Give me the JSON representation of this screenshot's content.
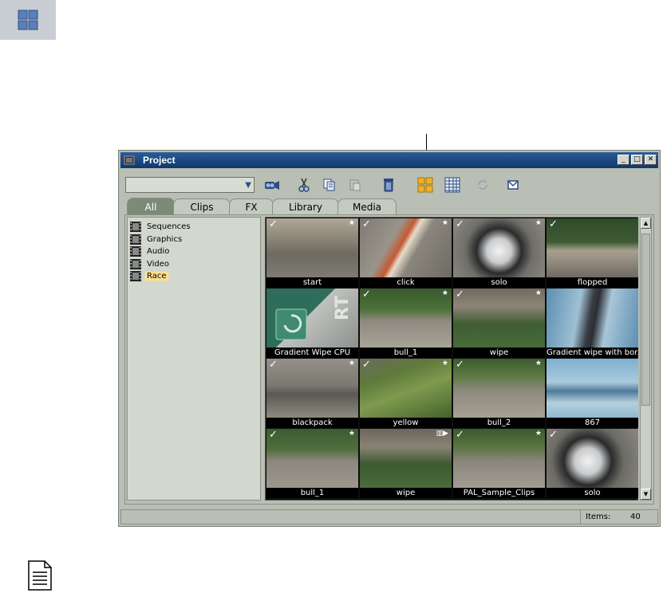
{
  "window": {
    "title": "Project",
    "minimize": "_",
    "maximize": "□",
    "close": "✕"
  },
  "toolbar": {
    "search_value": "",
    "dropdown_arrow": "▼",
    "active_view": "thumbnail"
  },
  "tabs": [
    {
      "label": "All",
      "active": true
    },
    {
      "label": "Clips",
      "active": false
    },
    {
      "label": "FX",
      "active": false
    },
    {
      "label": "Library",
      "active": false
    },
    {
      "label": "Media",
      "active": false
    }
  ],
  "tree": [
    {
      "label": "Sequences",
      "selected": false
    },
    {
      "label": "Graphics",
      "selected": false
    },
    {
      "label": "Audio",
      "selected": false
    },
    {
      "label": "Video",
      "selected": false
    },
    {
      "label": "Race",
      "selected": true
    }
  ],
  "thumbnails": [
    {
      "caption": "start",
      "check": "✓",
      "star": "★"
    },
    {
      "caption": "click",
      "check": "✓",
      "star": "★"
    },
    {
      "caption": "solo",
      "check": "✓",
      "star": "★"
    },
    {
      "caption": "flopped",
      "check": "✓",
      "star": ""
    },
    {
      "caption": "Gradient Wipe CPU",
      "check": "",
      "star": ""
    },
    {
      "caption": "bull_1",
      "check": "✓",
      "star": "★"
    },
    {
      "caption": "wipe",
      "check": "✓",
      "star": "★"
    },
    {
      "caption": "Gradient wipe with bor...",
      "check": "",
      "star": ""
    },
    {
      "caption": "blackpack",
      "check": "✓",
      "star": "★"
    },
    {
      "caption": "yellow",
      "check": "✓",
      "star": "★"
    },
    {
      "caption": "bull_2",
      "check": "✓",
      "star": "★"
    },
    {
      "caption": "867",
      "check": "",
      "star": ""
    },
    {
      "caption": "bull_1",
      "check": "✓",
      "star": "★"
    },
    {
      "caption": "wipe",
      "check": "",
      "star": ""
    },
    {
      "caption": "PAL_Sample_Clips",
      "check": "✓",
      "star": "★"
    },
    {
      "caption": "solo",
      "check": "✓",
      "star": ""
    }
  ],
  "status": {
    "items_label": "Items:",
    "items_count": "40"
  },
  "colors": {
    "titlebar": "#1f4a84",
    "active_tab": "#7c8a78",
    "selection": "#ffe089",
    "window_bg": "#b9bfb4"
  }
}
